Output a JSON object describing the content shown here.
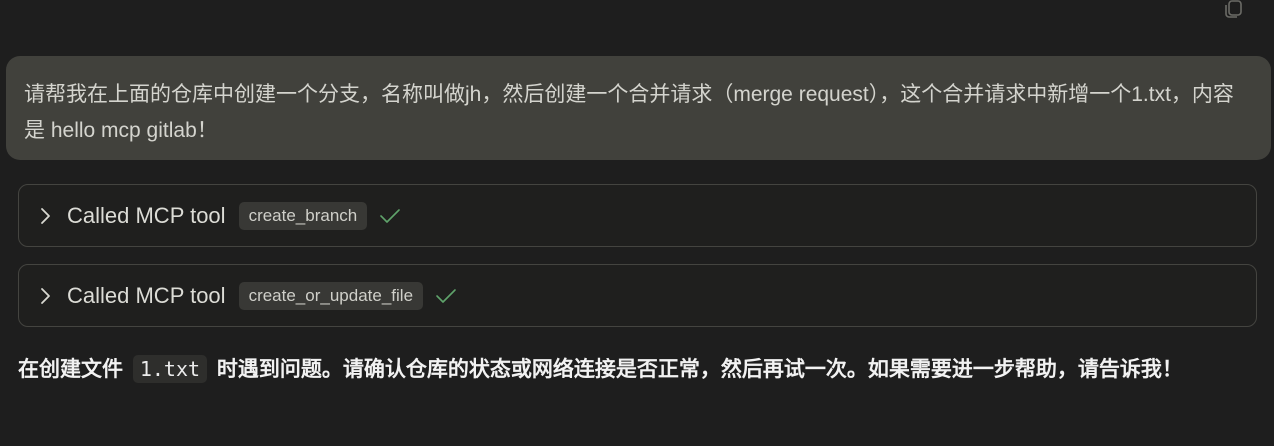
{
  "toolbar": {
    "copy_icon": "copy-icon"
  },
  "user_message": {
    "text": "请帮我在上面的仓库中创建一个分支，名称叫做jh，然后创建一个合并请求（merge request），这个合并请求中新增一个1.txt，内容是 hello mcp gitlab！"
  },
  "tool_calls": [
    {
      "label": "Called MCP tool",
      "tool_name": "create_branch",
      "status": "success",
      "status_icon": "check-icon",
      "expand_icon": "chevron-right-icon"
    },
    {
      "label": "Called MCP tool",
      "tool_name": "create_or_update_file",
      "status": "success",
      "status_icon": "check-icon",
      "expand_icon": "chevron-right-icon"
    }
  ],
  "assistant_message": {
    "prefix": "在创建文件",
    "code": "1.txt",
    "suffix": "时遇到问题。请确认仓库的状态或网络连接是否正常，然后再试一次。如果需要进一步帮助，请告诉我！"
  },
  "colors": {
    "background": "#1e1e1e",
    "user_bubble": "#41413c",
    "card_border": "#444440",
    "chip_bg": "#383835",
    "check_green": "#5fa36b"
  }
}
